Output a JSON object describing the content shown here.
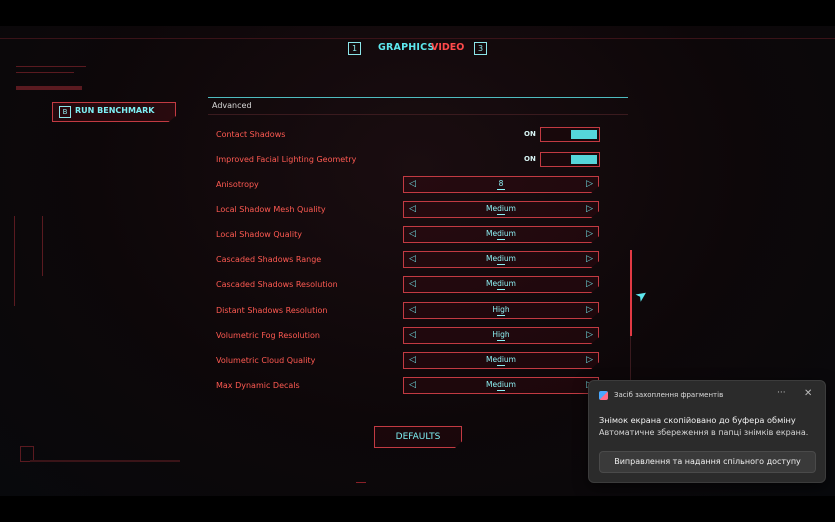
{
  "nav": {
    "key_left": "1",
    "tab_graphics": "GRAPHICS",
    "tab_video": "VIDEO",
    "key_right": "3"
  },
  "benchmark": {
    "key": "B",
    "label": "RUN BENCHMARK"
  },
  "panel": {
    "section_title": "Advanced",
    "rows": [
      {
        "label": "Contact Shadows",
        "type": "toggle",
        "value": "ON"
      },
      {
        "label": "Improved Facial Lighting Geometry",
        "type": "toggle",
        "value": "ON"
      },
      {
        "label": "Anisotropy",
        "type": "select",
        "value": "8"
      },
      {
        "label": "Local Shadow Mesh Quality",
        "type": "select",
        "value": "Medium"
      },
      {
        "label": "Local Shadow Quality",
        "type": "select",
        "value": "Medium"
      },
      {
        "label": "Cascaded Shadows Range",
        "type": "select",
        "value": "Medium"
      },
      {
        "label": "Cascaded Shadows Resolution",
        "type": "select",
        "value": "Medium"
      },
      {
        "label": "Distant Shadows Resolution",
        "type": "select",
        "value": "High"
      },
      {
        "label": "Volumetric Fog Resolution",
        "type": "select",
        "value": "High"
      },
      {
        "label": "Volumetric Cloud Quality",
        "type": "select",
        "value": "Medium"
      },
      {
        "label": "Max Dynamic Decals",
        "type": "select",
        "value": "Medium"
      }
    ]
  },
  "defaults_label": "DEFAULTS",
  "toast": {
    "app_name": "Засіб захоплення фрагментів",
    "more": "···",
    "close": "✕",
    "title": "Знімок екрана скопійовано до буфера обміну",
    "body": "Автоматичне збереження в папці знімків екрана.",
    "button": "Виправлення та надання спільного доступу"
  },
  "colors": {
    "accent_cyan": "#5ee8ee",
    "accent_red": "#ff4a4a",
    "border_red": "#c23a42"
  }
}
